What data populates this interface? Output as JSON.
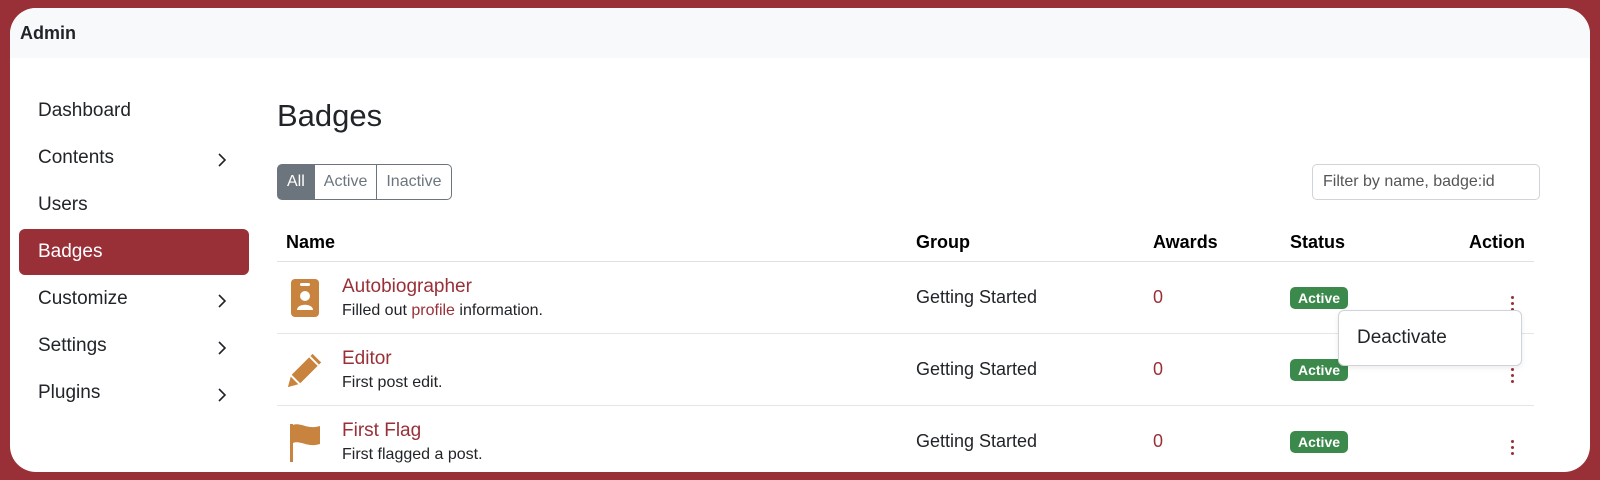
{
  "app": {
    "title": "Admin"
  },
  "sidebar": {
    "items": [
      {
        "label": "Dashboard"
      },
      {
        "label": "Contents"
      },
      {
        "label": "Users"
      },
      {
        "label": "Badges"
      },
      {
        "label": "Customize"
      },
      {
        "label": "Settings"
      },
      {
        "label": "Plugins"
      }
    ]
  },
  "page": {
    "title": "Badges"
  },
  "filters": {
    "all": "All",
    "active": "Active",
    "inactive": "Inactive",
    "selected": "All"
  },
  "search": {
    "placeholder": "Filter by name, badge:id"
  },
  "table": {
    "headers": {
      "name": "Name",
      "group": "Group",
      "awards": "Awards",
      "status": "Status",
      "action": "Action"
    },
    "rows": [
      {
        "icon": "id-badge-icon",
        "name": "Autobiographer",
        "desc_before": "Filled out ",
        "desc_link": "profile",
        "desc_after": " information.",
        "group": "Getting Started",
        "awards": "0",
        "status": "Active"
      },
      {
        "icon": "pencil-icon",
        "name": "Editor",
        "desc": "First post edit.",
        "group": "Getting Started",
        "awards": "0",
        "status": "Active"
      },
      {
        "icon": "flag-icon",
        "name": "First Flag",
        "desc": "First flagged a post.",
        "group": "Getting Started",
        "awards": "0",
        "status": "Active"
      }
    ]
  },
  "action_menu": {
    "item": "Deactivate"
  },
  "colors": {
    "brand": "#993038",
    "badge_icon": "#c8843f",
    "status_active": "#3b8a4c"
  }
}
